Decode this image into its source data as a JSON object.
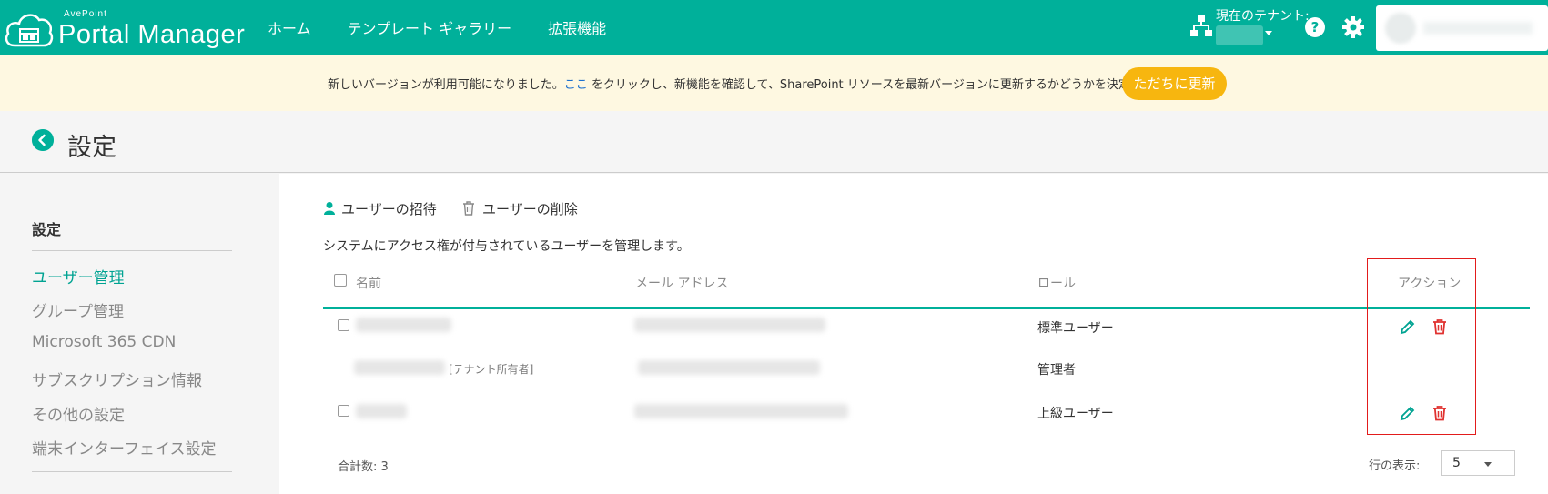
{
  "header": {
    "brand": "AvePoint",
    "app_name": "Portal Manager",
    "nav": [
      "ホーム",
      "テンプレート ギャラリー",
      "拡張機能"
    ],
    "tenant_label": "現在のテナント:",
    "help": "?"
  },
  "banner": {
    "text_before": "新しいバージョンが利用可能になりました。",
    "link": "ここ",
    "text_after": " をクリックし、新機能を確認して、SharePoint リソースを最新バージョンに更新するかどうかを決定してください。",
    "update_button": "ただちに更新"
  },
  "page": {
    "title": "設定"
  },
  "sidebar": {
    "heading": "設定",
    "items": [
      {
        "label": "ユーザー管理",
        "active": true
      },
      {
        "label": "グループ管理",
        "active": false
      },
      {
        "label": "Microsoft 365 CDN",
        "active": false
      },
      {
        "label": "サブスクリプション情報",
        "active": false
      },
      {
        "label": "その他の設定",
        "active": false
      },
      {
        "label": "端末インターフェイス設定",
        "active": false
      }
    ]
  },
  "toolbar": {
    "invite": "ユーザーの招待",
    "delete": "ユーザーの削除"
  },
  "description": "システムにアクセス権が付与されているユーザーを管理します。",
  "table": {
    "columns": {
      "name": "名前",
      "email": "メール アドレス",
      "role": "ロール",
      "actions": "アクション"
    },
    "rows": [
      {
        "role": "標準ユーザー",
        "owner_tag": "",
        "has_checkbox": true,
        "has_actions": true
      },
      {
        "role": "管理者",
        "owner_tag": "[テナント所有者]",
        "has_checkbox": false,
        "has_actions": false
      },
      {
        "role": "上級ユーザー",
        "owner_tag": "",
        "has_checkbox": true,
        "has_actions": true
      }
    ]
  },
  "footer": {
    "total": "合計数: 3",
    "rows_label": "行の表示:",
    "rows_value": "5"
  },
  "colors": {
    "brand": "#00b09a",
    "accent_button": "#f7b60f",
    "delete": "#e0312f",
    "highlight_box": "#e21b1b"
  }
}
